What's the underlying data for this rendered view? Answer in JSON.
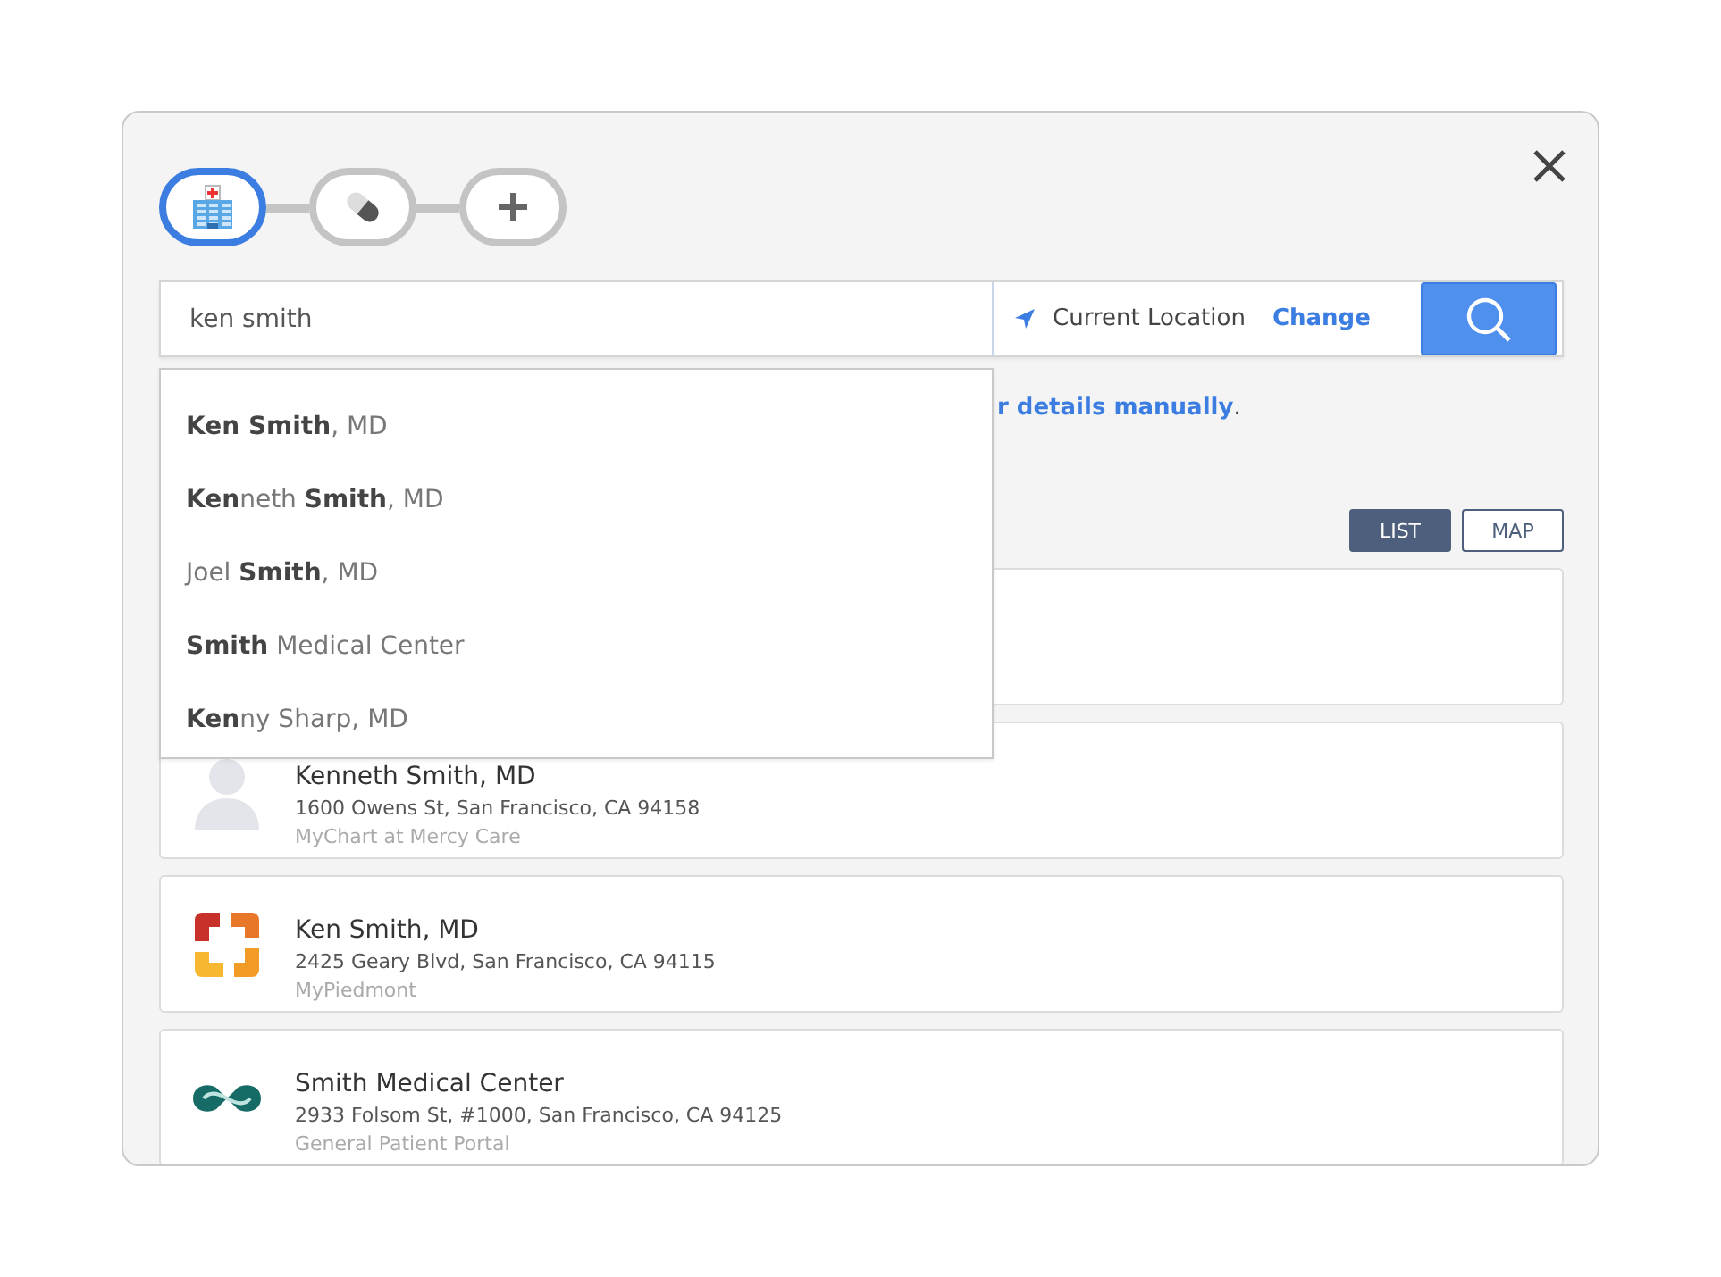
{
  "steps": [
    {
      "kind": "hospital",
      "selected": true
    },
    {
      "kind": "pill",
      "selected": false
    },
    {
      "kind": "plus",
      "selected": false
    }
  ],
  "search": {
    "value": "ken smith",
    "location": "Current Location",
    "change": "Change"
  },
  "suggestions": [
    {
      "text": "**Ken Smith**, MD"
    },
    {
      "text": "**Ken**neth **Smith**, MD"
    },
    {
      "text": "Joel **Smith**, MD"
    },
    {
      "text": "**Smith** Medical Center"
    },
    {
      "text": "**Ken**ny Sharp, MD"
    }
  ],
  "notice": {
    "link": "r details manually",
    "tail": "."
  },
  "view_toggle": [
    {
      "label": "LIST",
      "selected": true
    },
    {
      "label": "MAP",
      "selected": false
    }
  ],
  "results": [
    {
      "kind": "blank"
    },
    {
      "kind": "avatar",
      "name": "Kenneth Smith, MD",
      "address": "1600 Owens St, San Francisco, CA 94158",
      "portal": "MyChart at Mercy Care"
    },
    {
      "kind": "bracket",
      "name": "Ken Smith, MD",
      "address": "2425 Geary Blvd, San Francisco, CA 94115",
      "portal": "MyPiedmont"
    },
    {
      "kind": "infinity",
      "name": "Smith Medical Center",
      "address": "2933 Folsom St, #1000, San Francisco, CA 94125",
      "portal": "General Patient Portal"
    }
  ]
}
